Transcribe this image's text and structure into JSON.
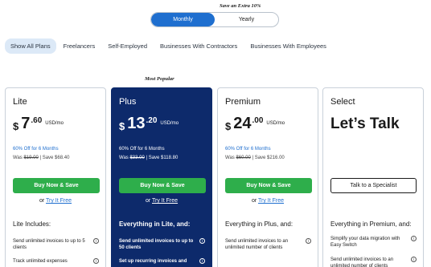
{
  "promo": "Save an Extra 10%",
  "toggle": {
    "monthly": "Monthly",
    "yearly": "Yearly"
  },
  "filters": [
    "Show All Plans",
    "Freelancers",
    "Self-Employed",
    "Businesses With Contractors",
    "Businesses With Employees"
  ],
  "most_popular": "Most Popular",
  "plans": [
    {
      "name": "Lite",
      "currency": "$",
      "price_main": "7",
      "price_cents": ".60",
      "per": "USD/mo",
      "offer": "60% Off for 6 Months",
      "was_prefix": "Was ",
      "was_price": "$19.00",
      "save": " | Save $68.40",
      "button": "Buy Now & Save",
      "or": "or",
      "try": "Try It Free",
      "includes": "Lite Includes:",
      "features": [
        "Send unlimited invoices to up to 5 clients",
        "Track unlimited expenses"
      ]
    },
    {
      "name": "Plus",
      "currency": "$",
      "price_main": "13",
      "price_cents": ".20",
      "per": "USD/mo",
      "offer": "60% Off for 6 Months",
      "was_prefix": "Was ",
      "was_price": "$33.00",
      "save": " | Save $118.80",
      "button": "Buy Now & Save",
      "or": "or",
      "try": "Try It Free",
      "includes": "Everything in Lite, and:",
      "features": [
        "Send unlimited invoices to up to 50 clients",
        "Set up recurring invoices and"
      ]
    },
    {
      "name": "Premium",
      "currency": "$",
      "price_main": "24",
      "price_cents": ".00",
      "per": "USD/mo",
      "offer": "60% Off for 6 Months",
      "was_prefix": "Was ",
      "was_price": "$60.00",
      "save": " | Save $216.00",
      "button": "Buy Now & Save",
      "or": "or",
      "try": "Try It Free",
      "includes": "Everything in Plus, and:",
      "features": [
        "Send unlimited invoices to an unlimited number of clients"
      ]
    },
    {
      "name": "Select",
      "talk": "Let’s Talk",
      "button": "Talk to a Specialist",
      "includes": "Everything in Premium, and:",
      "features": [
        "Simplify your data migration with Easy Switch",
        "Send unlimited invoices to an unlimited number of clients"
      ]
    }
  ],
  "colors": {
    "accent": "#1f6fcf",
    "green": "#2eae4b",
    "navy": "#0d2a6b"
  }
}
